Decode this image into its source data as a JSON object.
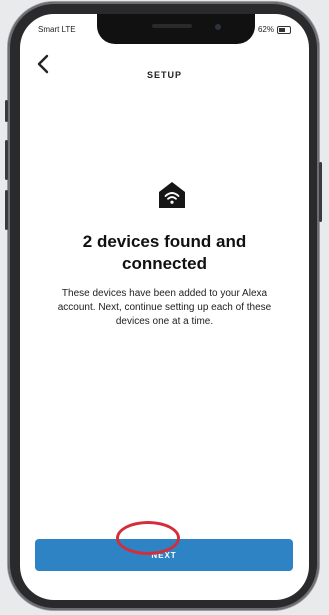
{
  "status_bar": {
    "carrier": "Smart LTE",
    "battery_text": "62%"
  },
  "header": {
    "title": "SETUP",
    "back_icon": "chevron-left-icon"
  },
  "content": {
    "icon": "smart-home-wifi-icon",
    "headline": "2 devices found and connected",
    "description": "These devices have been added to your Alexa account. Next, continue setting up each of these devices one at a time."
  },
  "footer": {
    "next_label": "NEXT"
  },
  "colors": {
    "button": "#2d83c4",
    "annotation_ring": "#d32f3a"
  }
}
